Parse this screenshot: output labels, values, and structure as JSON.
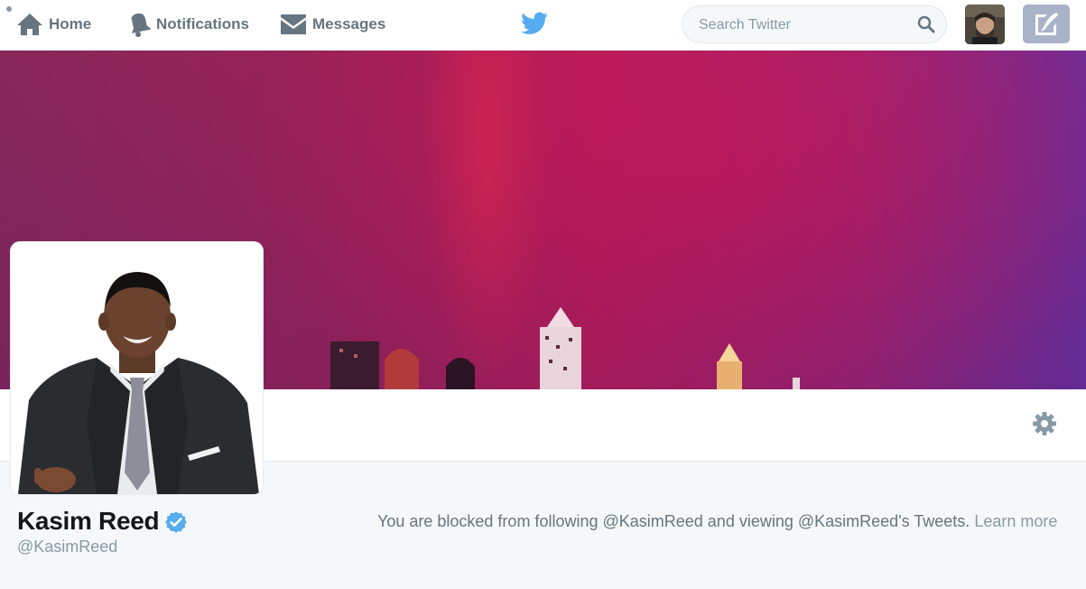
{
  "nav": {
    "home_label": "Home",
    "notifications_label": "Notifications",
    "messages_label": "Messages"
  },
  "search": {
    "placeholder": "Search Twitter"
  },
  "profile": {
    "name": "Kasim Reed",
    "handle": "@KasimReed",
    "verified": true
  },
  "blocked_notice": {
    "message": "You are blocked from following @KasimReed and viewing @KasimReed's Tweets.",
    "link_label": "Learn more"
  },
  "colors": {
    "brand_blue": "#55acee",
    "verified_blue": "#55acee",
    "nav_text": "#66757f",
    "muted_text": "#8899a6",
    "compose_bg": "#a9b3c8"
  },
  "icons": [
    "home-icon",
    "bell-icon",
    "envelope-icon",
    "twitter-bird-icon",
    "search-icon",
    "compose-icon",
    "gear-icon",
    "verified-badge-icon"
  ]
}
